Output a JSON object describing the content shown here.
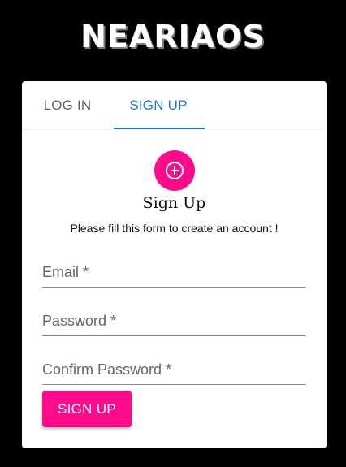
{
  "app": {
    "logo_text": "NEARIAOS"
  },
  "tabs": [
    {
      "label": "LOG IN",
      "active": false
    },
    {
      "label": "SIGN UP",
      "active": true
    }
  ],
  "form": {
    "icon": "add-circle-icon",
    "title": "Sign Up",
    "subtitle": "Please fill this form to create an account !",
    "fields": {
      "email": {
        "placeholder": "Email *",
        "value": ""
      },
      "password": {
        "placeholder": "Password *",
        "value": ""
      },
      "confirm_password": {
        "placeholder": "Confirm Password *",
        "value": ""
      }
    },
    "submit_label": "SIGN UP"
  },
  "colors": {
    "background": "#000000",
    "card": "#ffffff",
    "accent": "#ff0a8b",
    "tab_active": "#1976d2",
    "tab_inactive": "#5f5f5f"
  }
}
